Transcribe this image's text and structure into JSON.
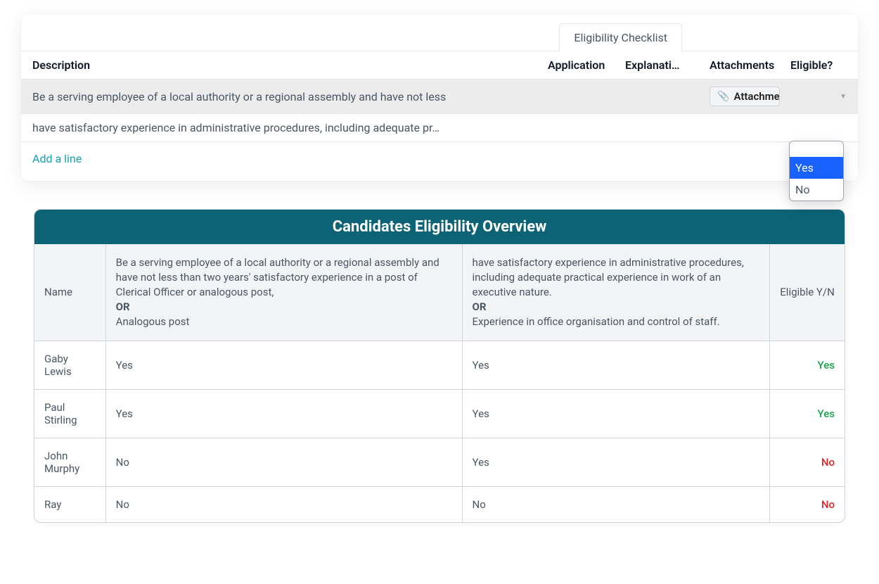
{
  "tab_label": "Eligibility Checklist",
  "columns": {
    "description": "Description",
    "application": "Application",
    "explanation": "Explanati…",
    "attachments": "Attachments",
    "eligible": "Eligible?"
  },
  "rows": [
    {
      "description": "Be a serving employee of a local authority or a regional assembly and have not less",
      "attachments_label": "Attachme"
    },
    {
      "description": "have satisfactory experience in administrative procedures, including adequate pr…"
    }
  ],
  "add_line": "Add a line",
  "dropdown": {
    "blank": "",
    "yes": "Yes",
    "no": "No"
  },
  "overview": {
    "title": "Candidates Eligibility Overview",
    "headers": {
      "name": "Name",
      "crit1_line1": "Be a serving employee of a local authority or a regional assembly and have not less than two years' satisfactory experience in a post of Clerical Officer or analogous post,",
      "crit1_or": "OR",
      "crit1_line2": "Analogous post",
      "crit2_line1": "have satisfactory experience in administrative procedures, including adequate practical experience in work of an executive nature.",
      "crit2_or": "OR",
      "crit2_line2": "Experience in office organisation and control of staff.",
      "elig": "Eligible Y/N"
    },
    "rows": [
      {
        "name": "Gaby Lewis",
        "c1": "Yes",
        "c2": "Yes",
        "elig": "Yes"
      },
      {
        "name": "Paul Stirling",
        "c1": "Yes",
        "c2": "Yes",
        "elig": "Yes"
      },
      {
        "name": "John Murphy",
        "c1": "No",
        "c2": "Yes",
        "elig": "No"
      },
      {
        "name": "Ray",
        "c1": "No",
        "c2": "No",
        "elig": "No"
      }
    ]
  }
}
